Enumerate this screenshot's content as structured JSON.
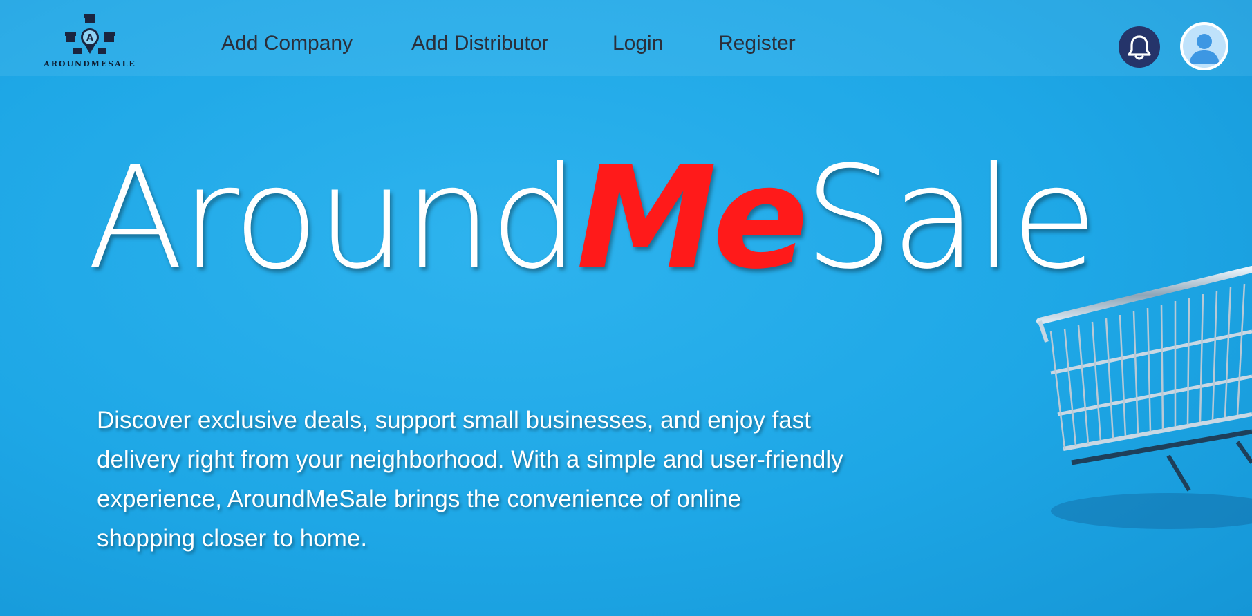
{
  "brand": {
    "logo_text": "AROUNDMESALE"
  },
  "nav": {
    "items": [
      {
        "label": "Add Company"
      },
      {
        "label": "Add Distributor"
      },
      {
        "label": "Login"
      },
      {
        "label": "Register"
      }
    ]
  },
  "header_icons": {
    "notifications": "bell-icon",
    "profile": "user-avatar-icon"
  },
  "hero": {
    "title_start": "Around",
    "title_accent": "Me",
    "title_end": "Sale",
    "description": "Discover exclusive deals, support small businesses, and enjoy fast delivery right from your neighborhood. With a simple and user-friendly experience, AroundMeSale brings the convenience of online shopping closer to home."
  },
  "colors": {
    "background": "#1ea7e6",
    "accent_red": "#ff1a1a",
    "bell_bg": "#25346a",
    "nav_text": "#2b2f3a"
  }
}
